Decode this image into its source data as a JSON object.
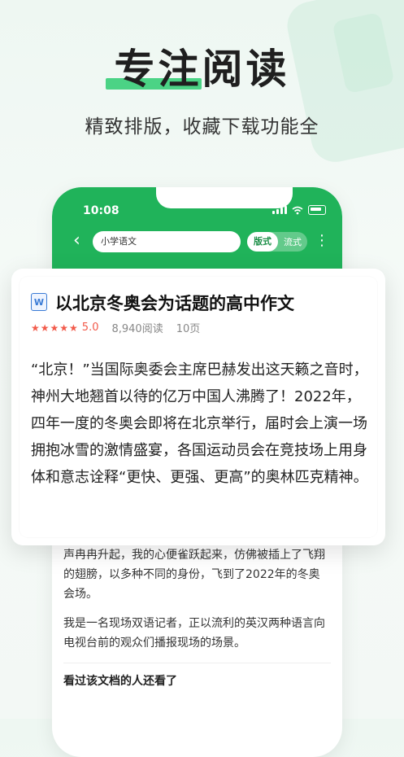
{
  "hero": {
    "title": "专注阅读",
    "subtitle": "精致排版，收藏下载功能全"
  },
  "phone": {
    "status_time": "10:08",
    "search_text": "小学语文",
    "toggle_on": "版式",
    "toggle_off": "流式",
    "body_paragraphs": [
      "声冉冉升起，我的心便雀跃起来，仿佛被插上了飞翔的翅膀，以多种不同的身份，飞到了2022年的冬奥会场。",
      "我是一名现场双语记者，正以流利的英汉两种语言向电视台前的观众们播报现场的场景。"
    ],
    "related_heading": "看过该文档的人还看了"
  },
  "card": {
    "icon_letter": "W",
    "title": "以北京冬奥会为话题的高中作文",
    "stars": "★★★★★",
    "rating": "5.0",
    "reads": "8,940阅读",
    "pages": "10页",
    "text": "“北京！”当国际奥委会主席巴赫发出这天籁之音时，神州大地翘首以待的亿万中国人沸腾了！2022年，四年一度的冬奥会即将在北京举行，届时会上演一场拥抱冰雪的激情盛宴，各国运动员会在竞技场上用身体和意志诠释“更快、更强、更高”的奥林匹克精神。"
  },
  "colors": {
    "accent": "#20b35a",
    "star": "#f25a4a"
  }
}
